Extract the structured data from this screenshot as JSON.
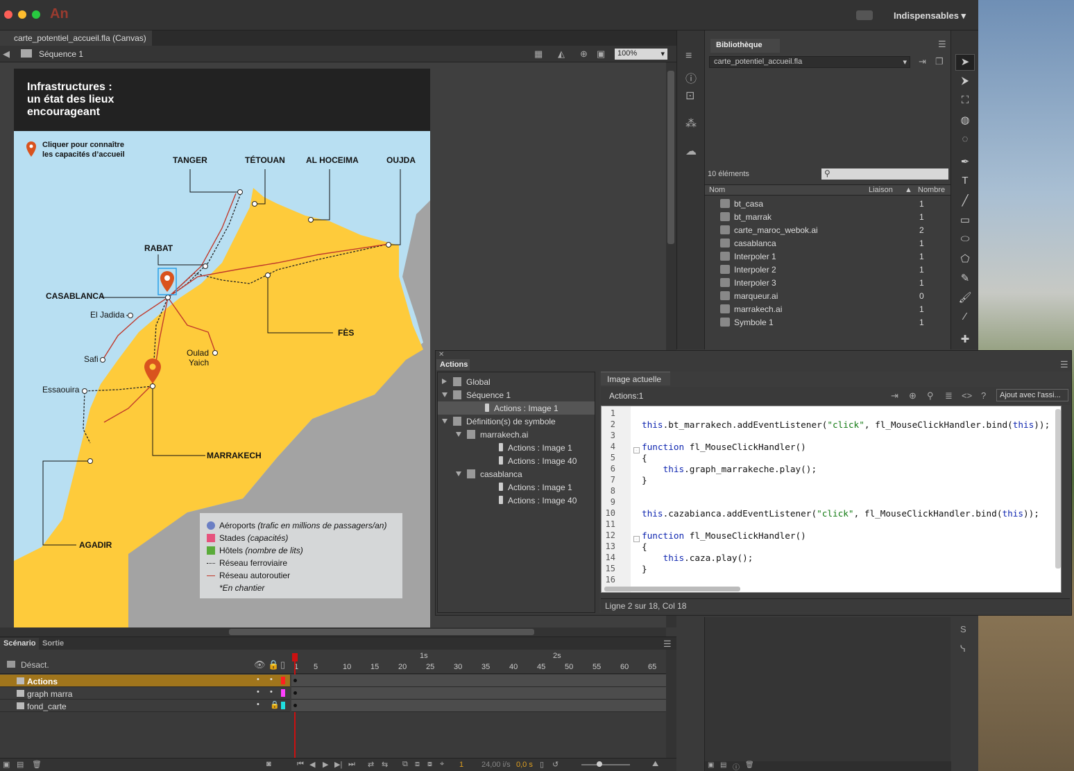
{
  "app": {
    "logo": "An",
    "workspace": "Indispensables ▾"
  },
  "document": {
    "tab_title": "carte_potentiel_accueil.fla (Canvas)",
    "scene": "Séquence 1",
    "zoom": "100%"
  },
  "map": {
    "title_line1": "Infrastructures :",
    "title_line2": "un état des lieux",
    "title_line3": "encourageant",
    "hint_line1": "Cliquer pour connaître",
    "hint_line2": "les capacités d’accueil",
    "cities": {
      "tanger": "TANGER",
      "tetouan": "TÉTOUAN",
      "alhoceima": "AL HOCEIMA",
      "oujda": "OUJDA",
      "rabat": "RABAT",
      "casablanca": "CASABLANCA",
      "eljadida": "El Jadida",
      "fes": "FÈS",
      "safi": "Safi",
      "ouladyaich1": "Oulad",
      "ouladyaich2": "Yaich",
      "essaouira": "Essaouira",
      "marrakech": "MARRAKECH",
      "agadir": "AGADIR"
    },
    "legend": {
      "airports_label": "Aéroports",
      "airports_note": "(trafic en millions de passagers/an)",
      "stadiums_label": "Stades",
      "stadiums_note": "(capacités)",
      "hotels_label": "Hôtels",
      "hotels_note": "(nombre de lits)",
      "rail": "Réseau ferroviaire",
      "road": "Réseau autoroutier",
      "construction": "*En chantier"
    },
    "colors": {
      "land": "#fecb3b",
      "sea": "#b8dff2",
      "neighbour": "#a3a3a3",
      "marker": "#d9531e",
      "road": "#c0392b"
    }
  },
  "library": {
    "tab": "Bibliothèque",
    "file": "carte_potentiel_accueil.fla",
    "count": "10 éléments",
    "col_name": "Nom",
    "col_link": "Liaison",
    "col_count": "Nombre",
    "items": [
      {
        "name": "bt_casa",
        "count": "1",
        "icon": "button-icon"
      },
      {
        "name": "bt_marrak",
        "count": "1",
        "icon": "button-icon"
      },
      {
        "name": "carte_maroc_webok.ai",
        "count": "2",
        "icon": "graphic-icon"
      },
      {
        "name": "casablanca",
        "count": "1",
        "icon": "movieclip-icon"
      },
      {
        "name": "Interpoler 1",
        "count": "1",
        "icon": "graphic-icon"
      },
      {
        "name": "Interpoler 2",
        "count": "1",
        "icon": "graphic-icon"
      },
      {
        "name": "Interpoler 3",
        "count": "1",
        "icon": "graphic-icon"
      },
      {
        "name": "marqueur.ai",
        "count": "0",
        "icon": "graphic-icon"
      },
      {
        "name": "marrakech.ai",
        "count": "1",
        "icon": "movieclip-icon"
      },
      {
        "name": "Symbole 1",
        "count": "1",
        "icon": "graphic-icon"
      }
    ]
  },
  "actions": {
    "tab": "Actions",
    "tree": [
      {
        "label": "Global",
        "indent": 0,
        "arrow": "right",
        "icon": "folder"
      },
      {
        "label": "Séquence 1",
        "indent": 0,
        "arrow": "down",
        "icon": "scene"
      },
      {
        "label": "Actions : Image 1",
        "indent": 1,
        "arrow": "",
        "icon": "doc",
        "selected": true
      },
      {
        "label": "Définition(s) de symbole",
        "indent": 0,
        "arrow": "down",
        "icon": "symbol"
      },
      {
        "label": "marrakech.ai",
        "indent": 1,
        "arrow": "down",
        "icon": "movieclip"
      },
      {
        "label": "Actions : Image 1",
        "indent": 2,
        "arrow": "",
        "icon": "doc"
      },
      {
        "label": "Actions : Image 40",
        "indent": 2,
        "arrow": "",
        "icon": "doc"
      },
      {
        "label": "casablanca",
        "indent": 1,
        "arrow": "down",
        "icon": "movieclip"
      },
      {
        "label": "Actions : Image 1",
        "indent": 2,
        "arrow": "",
        "icon": "doc"
      },
      {
        "label": "Actions : Image 40",
        "indent": 2,
        "arrow": "",
        "icon": "doc"
      }
    ],
    "code_tab": "Image actuelle",
    "code_context": "Actions:1",
    "assistant_button": "Ajout avec l'assi...",
    "status": "Ligne 2 sur 18, Col 18",
    "line_numbers": [
      "1",
      "2",
      "3",
      "4",
      "5",
      "6",
      "7",
      "8",
      "9",
      "10",
      "11",
      "12",
      "13",
      "14",
      "15",
      "16"
    ],
    "code": [
      "",
      "this.bt_marrakech.addEventListener(\"click\", fl_MouseClickHandler.bind(this));",
      "",
      "function fl_MouseClickHandler()",
      "{",
      "    this.graph_marrakeche.play();",
      "}",
      "",
      "",
      "this.cazabianca.addEventListener(\"click\", fl_MouseClickHandler.bind(this));",
      "",
      "function fl_MouseClickHandler()",
      "{",
      "    this.caza.play();",
      "}",
      ""
    ]
  },
  "timeline": {
    "tab_scenario": "Scénario",
    "tab_output": "Sortie",
    "disabled_label": "Désact.",
    "sec1": "1s",
    "sec2": "2s",
    "ticks": [
      "1",
      "5",
      "10",
      "15",
      "20",
      "25",
      "30",
      "35",
      "40",
      "45",
      "50",
      "55",
      "60",
      "65"
    ],
    "layers": [
      {
        "name": "Actions",
        "color": "#ff2020",
        "selected": true
      },
      {
        "name": "graph marra",
        "color": "#ff40ff",
        "selected": false
      },
      {
        "name": "fond_carte",
        "color": "#20e0e0",
        "selected": false
      }
    ],
    "frame": "1",
    "fps": "24,00 i/s",
    "time": "0,0 s"
  }
}
